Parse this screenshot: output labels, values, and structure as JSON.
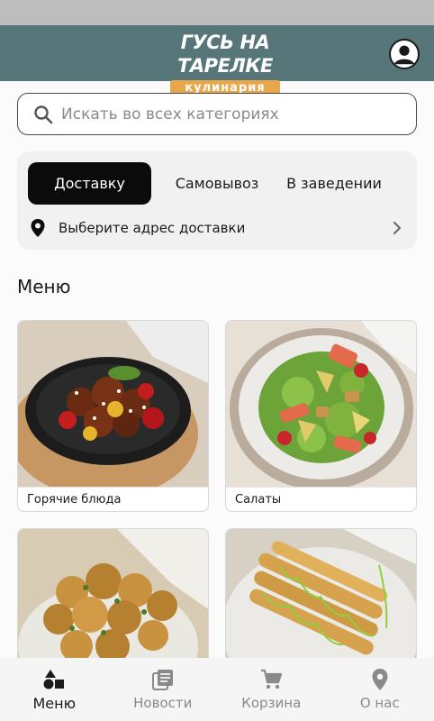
{
  "header": {
    "logo_title": "ГУСЬ НА ТАРЕЛКЕ",
    "logo_subtitle": "кулинария",
    "profile_icon": "account-circle-icon"
  },
  "search": {
    "placeholder": "Искать во всех категориях",
    "icon": "search-icon"
  },
  "delivery": {
    "tabs": [
      {
        "label": "Доставку",
        "active": true
      },
      {
        "label": "Самовывоз",
        "active": false
      },
      {
        "label": "В заведении",
        "active": false
      }
    ],
    "address_label": "Выберите адрес доставки",
    "address_icon": "location-pin-icon",
    "chevron_icon": "chevron-right-icon"
  },
  "menu": {
    "title": "Меню",
    "categories": [
      {
        "label": "Горячие блюда",
        "image": "hot-dishes-photo"
      },
      {
        "label": "Салаты",
        "image": "salads-photo"
      },
      {
        "label": "",
        "image": "potatoes-photo"
      },
      {
        "label": "",
        "image": "fried-shrimp-photo"
      }
    ]
  },
  "bottom_nav": [
    {
      "label": "Меню",
      "icon": "shapes-icon",
      "active": true
    },
    {
      "label": "Новости",
      "icon": "news-icon",
      "active": false
    },
    {
      "label": "Корзина",
      "icon": "cart-icon",
      "active": false
    },
    {
      "label": "О нас",
      "icon": "location-pin-icon",
      "active": false
    }
  ],
  "colors": {
    "header": "#57767a",
    "logo_ribbon": "#e8a74a",
    "active_tab": "#0b0b0b",
    "status_bar": "#bdbdbd"
  }
}
